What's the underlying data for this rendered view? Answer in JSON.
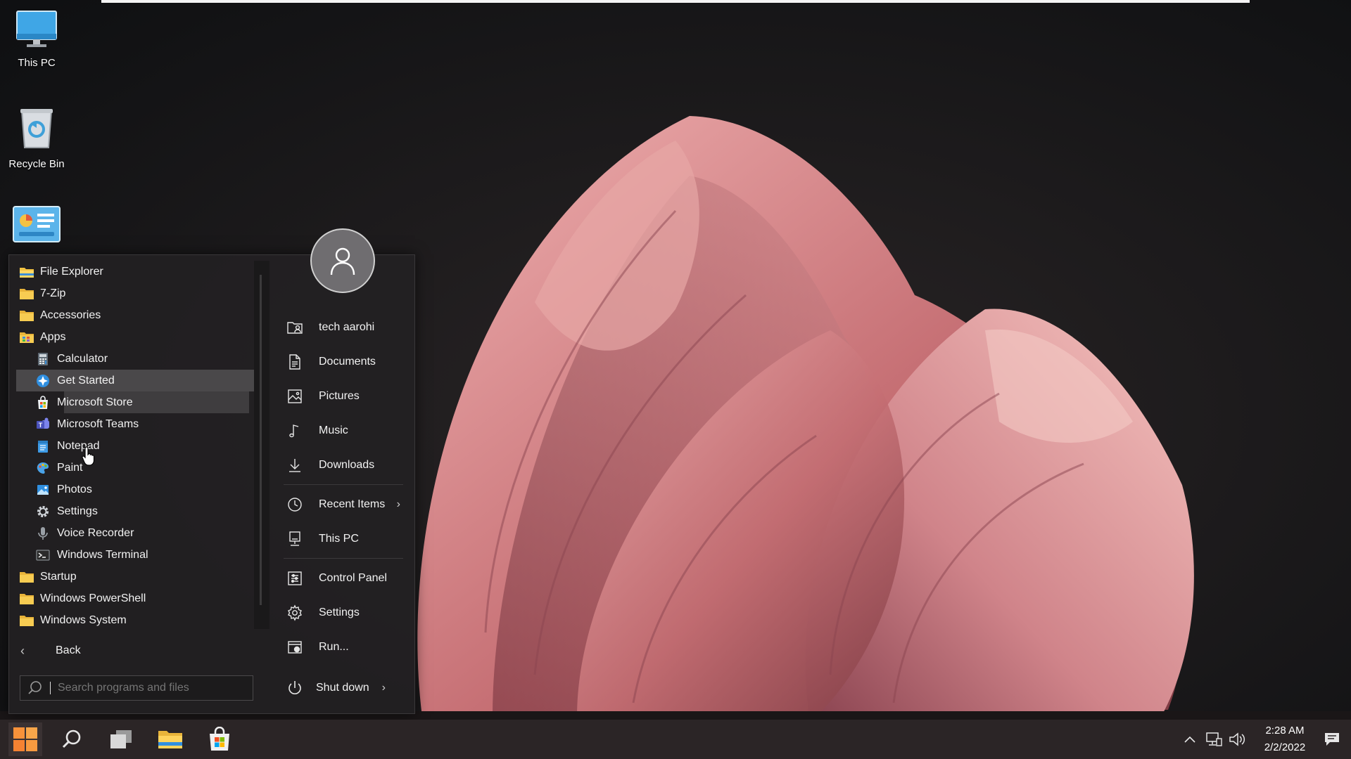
{
  "desktop": {
    "icons": [
      {
        "label": "This PC",
        "icon": "monitor-icon"
      },
      {
        "label": "Recycle Bin",
        "icon": "recycle-bin-icon"
      },
      {
        "label": "",
        "icon": "control-panel-icon"
      }
    ]
  },
  "start_menu": {
    "programs": [
      {
        "label": "File Explorer",
        "icon": "file-explorer-icon",
        "level": 0
      },
      {
        "label": "7-Zip",
        "icon": "folder-icon",
        "level": 0
      },
      {
        "label": "Accessories",
        "icon": "folder-icon",
        "level": 0
      },
      {
        "label": "Apps",
        "icon": "apps-folder-icon",
        "level": 0
      },
      {
        "label": "Calculator",
        "icon": "calculator-icon",
        "level": 1
      },
      {
        "label": "Get Started",
        "icon": "get-started-icon",
        "level": 1
      },
      {
        "label": "Microsoft Store",
        "icon": "store-icon",
        "level": 1
      },
      {
        "label": "Microsoft Teams",
        "icon": "teams-icon",
        "level": 1
      },
      {
        "label": "Notepad",
        "icon": "notepad-icon",
        "level": 1
      },
      {
        "label": "Paint",
        "icon": "paint-icon",
        "level": 1
      },
      {
        "label": "Photos",
        "icon": "photos-icon",
        "level": 1
      },
      {
        "label": "Settings",
        "icon": "settings-gear-icon",
        "level": 1
      },
      {
        "label": "Voice Recorder",
        "icon": "microphone-icon",
        "level": 1
      },
      {
        "label": "Windows Terminal",
        "icon": "terminal-icon",
        "level": 1
      },
      {
        "label": "Startup",
        "icon": "folder-icon",
        "level": 0
      },
      {
        "label": "Windows PowerShell",
        "icon": "folder-icon",
        "level": 0
      },
      {
        "label": "Windows System",
        "icon": "folder-icon",
        "level": 0
      }
    ],
    "back_label": "Back",
    "search_placeholder": "Search programs and files",
    "places": [
      {
        "label": "tech aarohi",
        "icon": "user-folder-icon"
      },
      {
        "label": "Documents",
        "icon": "document-icon"
      },
      {
        "label": "Pictures",
        "icon": "picture-icon"
      },
      {
        "label": "Music",
        "icon": "music-note-icon"
      },
      {
        "label": "Downloads",
        "icon": "download-icon"
      },
      {
        "label": "Recent Items",
        "icon": "clock-icon",
        "has_submenu": true
      },
      {
        "label": "This PC",
        "icon": "computer-icon"
      },
      {
        "label": "Control Panel",
        "icon": "control-panel-icon"
      },
      {
        "label": "Settings",
        "icon": "settings-gear-icon"
      },
      {
        "label": "Run...",
        "icon": "run-icon"
      }
    ],
    "shutdown_label": "Shut down"
  },
  "taskbar": {
    "items": [
      "start-icon",
      "search-icon",
      "task-view-icon",
      "file-explorer-icon",
      "store-icon"
    ],
    "tray": {
      "time": "2:28 AM",
      "date": "2/2/2022"
    }
  },
  "colors": {
    "menu_bg": "#222022",
    "highlight": "#4a484a",
    "taskbar_bg": "#2b2526",
    "wallpaper_petal": "#c56e73"
  }
}
